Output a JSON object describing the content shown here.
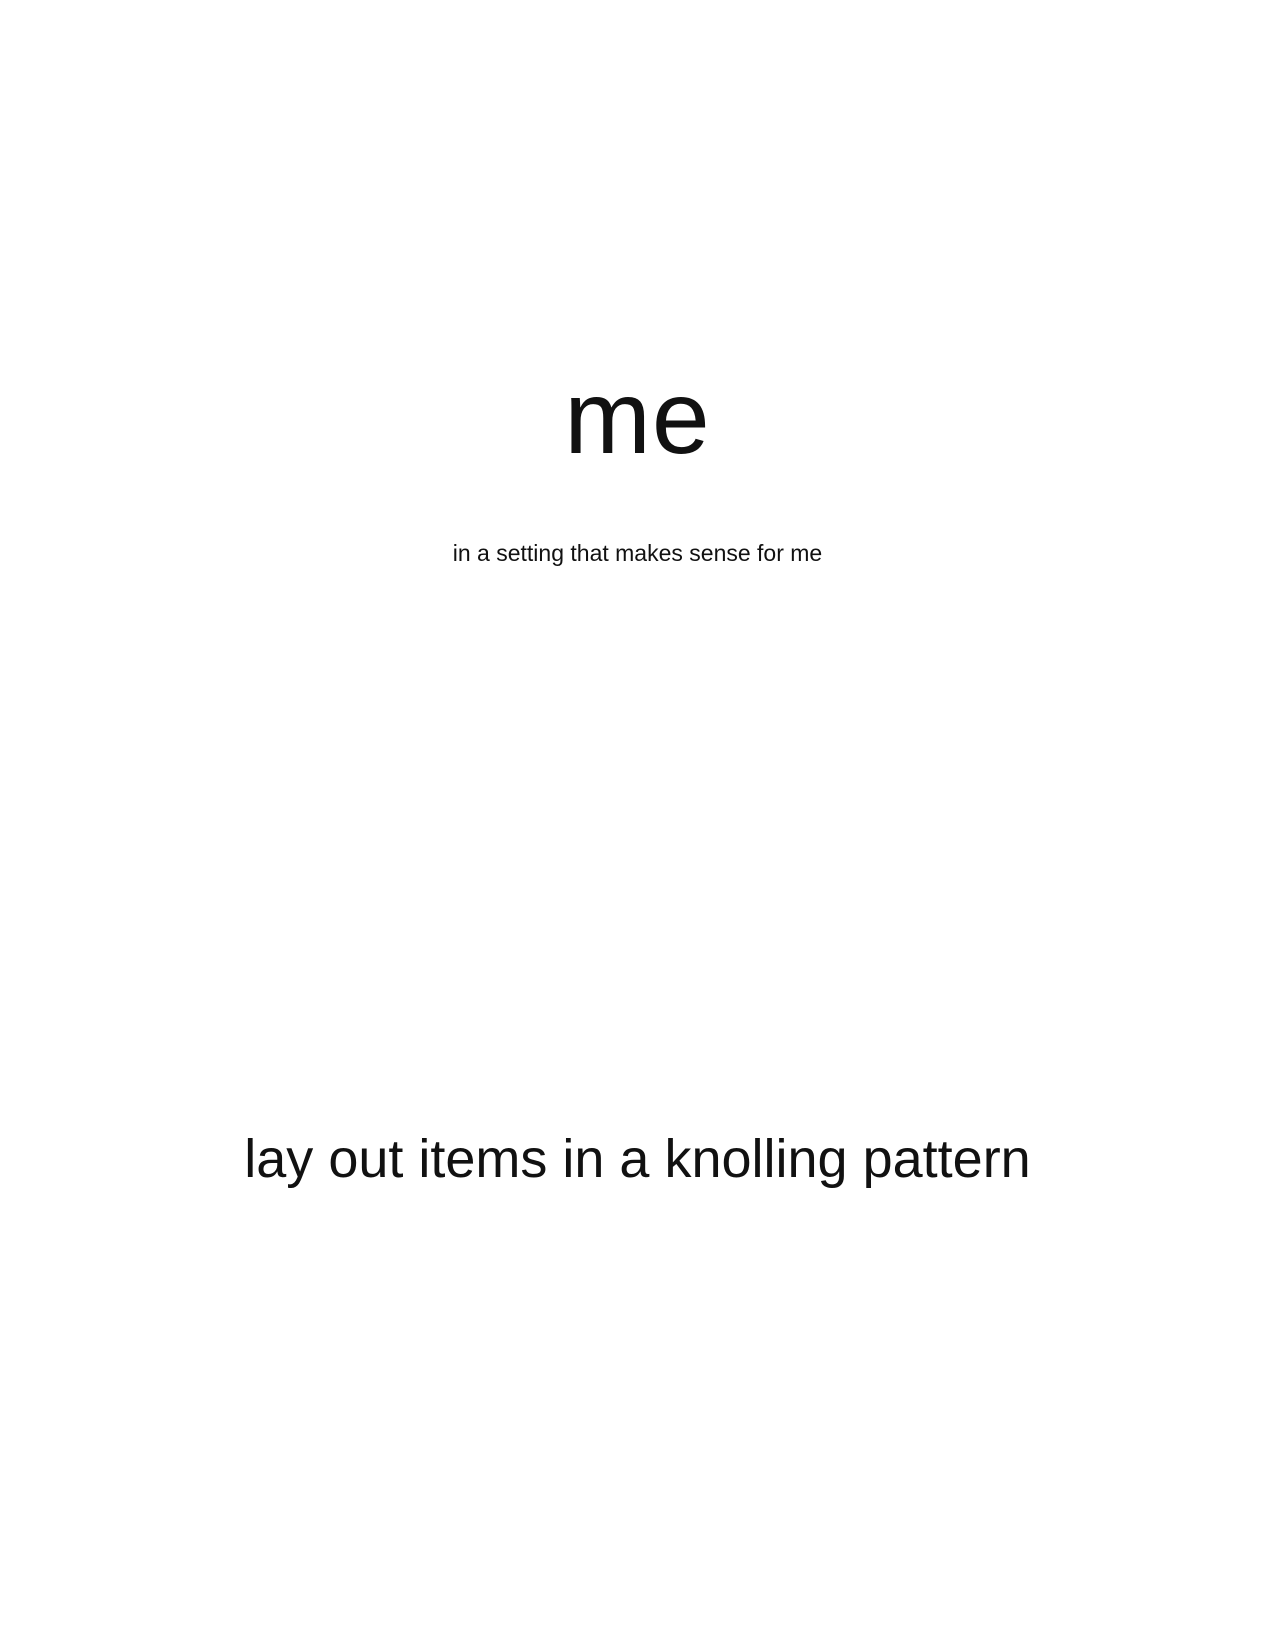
{
  "document": {
    "title": "me",
    "subtitle": "in a setting that makes sense for me",
    "instruction": "lay out items in a knolling pattern"
  },
  "colors": {
    "background": "#ffffff",
    "text": "#111111"
  }
}
